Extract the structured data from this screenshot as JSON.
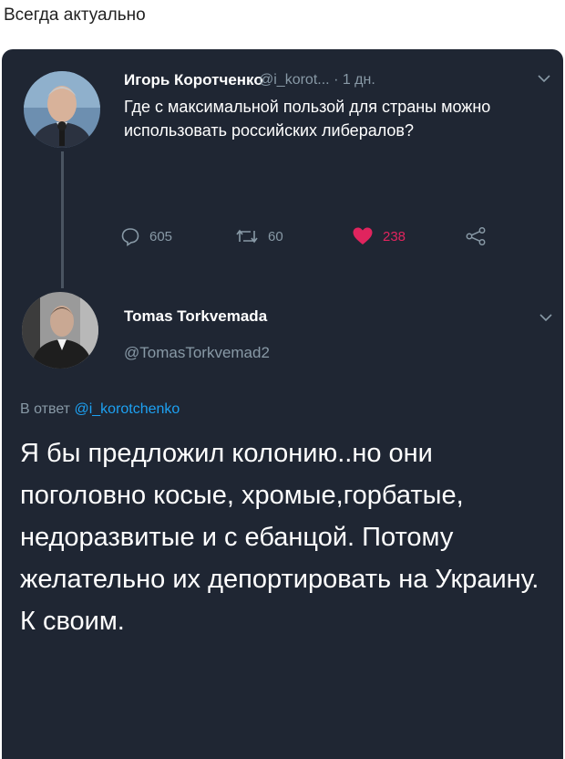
{
  "caption": "Всегда актуально",
  "tweet1": {
    "author_name": "Игорь Коротченко",
    "handle": "@i_korot...",
    "time": "· 1 дн.",
    "text": "Где с максимальной пользой для страны можно использовать российских либералов?",
    "replies": "605",
    "retweets": "60",
    "likes": "238"
  },
  "tweet2": {
    "author_name": "Tomas Torkvemada",
    "handle": "@TomasTorkvemad2",
    "reply_prefix": "В ответ",
    "reply_mention": "@i_korotchenko",
    "text": "Я бы предложил колонию..но они поголовно косые, хромые,горбатые, недоразвитые и с ебанцой. Потому желательно их депортировать на Украину. К своим."
  },
  "icons": {
    "reply": "reply-icon",
    "retweet": "retweet-icon",
    "like": "heart-icon",
    "share": "share-icon",
    "menu": "chevron-down-icon"
  },
  "colors": {
    "background": "#1f2633",
    "like": "#e0245e",
    "link": "#1da1f2",
    "muted": "#8899a6"
  }
}
